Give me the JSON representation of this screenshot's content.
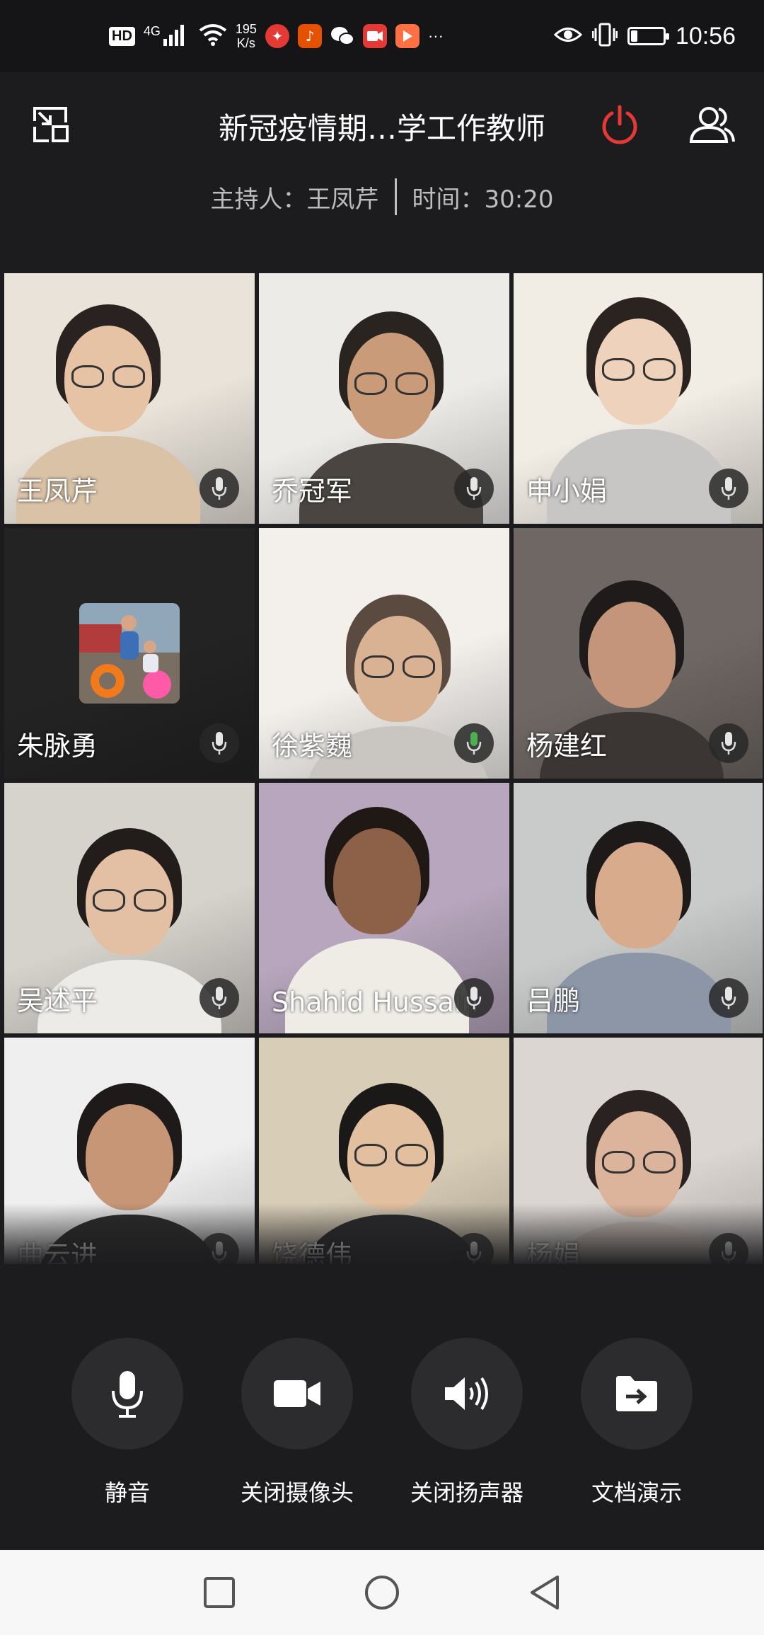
{
  "status_bar": {
    "hd_badge": "HD",
    "network_type": "4G",
    "net_speed_value": "195",
    "net_speed_unit": "K/s",
    "more": "···",
    "time": "10:56",
    "battery_level": 0.2
  },
  "header": {
    "title": "新冠疫情期…学工作教师",
    "host_label": "主持人：王凤芹",
    "time_label": "时间：30:20"
  },
  "participants": [
    {
      "name": "王凤芹",
      "bg": "#e9e3da",
      "skin": "#e6c3a5",
      "hair": "#2a2220",
      "shirt": "#d9c2a6",
      "glasses": true
    },
    {
      "name": "乔冠军",
      "bg": "#ecebe8",
      "skin": "#c99b78",
      "hair": "#2a2420",
      "shirt": "#4a4540",
      "glasses": true
    },
    {
      "name": "申小娟",
      "bg": "#f1ece4",
      "skin": "#efd2bb",
      "hair": "#2b2320",
      "shirt": "#c8c6c4",
      "glasses": true
    },
    {
      "name": "朱脉勇",
      "bg": "#232323",
      "avatar": true
    },
    {
      "name": "徐紫巍",
      "bg": "#f3f0ec",
      "skin": "#d9b294",
      "hair": "#5a4a40",
      "shirt": "#c9c6c2",
      "glasses": true,
      "mic_active": true
    },
    {
      "name": "杨建红",
      "bg": "#6f6763",
      "skin": "#c4957a",
      "hair": "#1f1b1a",
      "shirt": "#3b3533",
      "glasses": false
    },
    {
      "name": "吴述平",
      "bg": "#d6d2cc",
      "skin": "#e3c0a4",
      "hair": "#221c1a",
      "shirt": "#ecebe8",
      "glasses": true
    },
    {
      "name": "Shahid Hussain",
      "bg": "#b7a6bd",
      "skin": "#8d6048",
      "hair": "#1f1815",
      "shirt": "#efece6",
      "glasses": false
    },
    {
      "name": "吕鹏",
      "bg": "#c9cbcb",
      "skin": "#d7ab8c",
      "hair": "#1e1a19",
      "shirt": "#8d96a6",
      "glasses": false
    },
    {
      "name": "曲云进",
      "bg": "#efefef",
      "skin": "#c69677",
      "hair": "#1d1a19",
      "shirt": "#2c2a2a",
      "glasses": false
    },
    {
      "name": "饶德伟",
      "bg": "#d8cdb7",
      "skin": "#e2bf9f",
      "hair": "#1b1818",
      "shirt": "#2a2a2c",
      "glasses": true
    },
    {
      "name": "杨娟",
      "bg": "#dcd6d2",
      "skin": "#dcb49c",
      "hair": "#2a2220",
      "shirt": "#c6b9b2",
      "glasses": true
    }
  ],
  "toolbar": {
    "mute": "静音",
    "camera_off": "关闭摄像头",
    "speaker_off": "关闭扬声器",
    "doc_share": "文档演示"
  },
  "colors": {
    "leave_red": "#e53935",
    "mic_active_green": "#4caf50"
  }
}
